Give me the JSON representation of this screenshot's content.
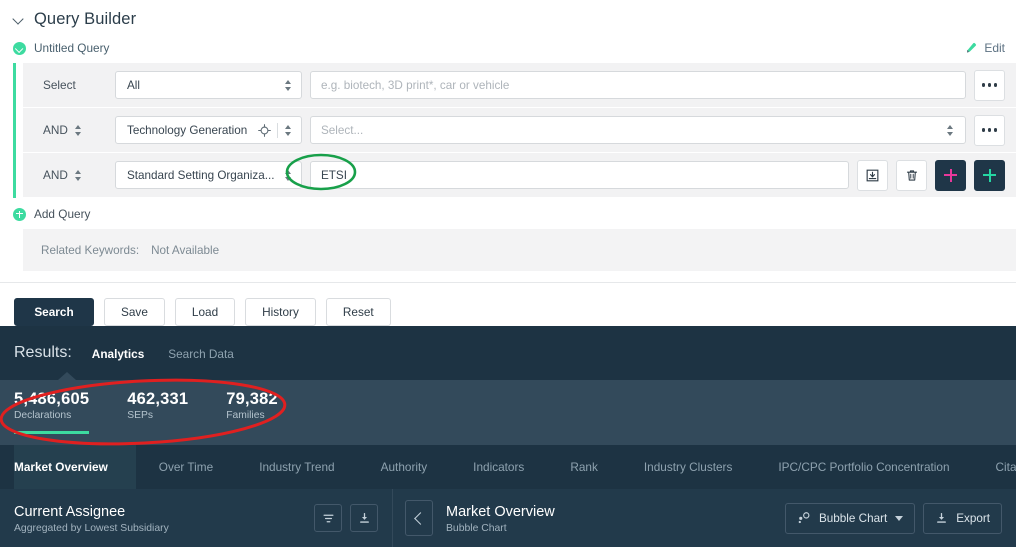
{
  "query_builder": {
    "title": "Query Builder",
    "query_name": "Untitled Query",
    "edit_label": "Edit",
    "add_query_label": "Add Query",
    "rows": [
      {
        "connector": "Select",
        "field": "All",
        "value": "",
        "placeholder": "e.g. biotech, 3D print*, car or vehicle",
        "menu_label": "•••"
      },
      {
        "connector": "AND",
        "field": "Technology Generation",
        "value": "",
        "placeholder": "Select...",
        "menu_label": "•••"
      },
      {
        "connector": "AND",
        "field": "Standard Setting Organiza...",
        "value": "ETSI",
        "placeholder": "",
        "menu_label": ""
      }
    ],
    "keywords": {
      "label": "Related Keywords:",
      "value": "Not Available"
    },
    "buttons": [
      {
        "label": "Search",
        "primary": true
      },
      {
        "label": "Save",
        "primary": false
      },
      {
        "label": "Load",
        "primary": false
      },
      {
        "label": "History",
        "primary": false
      },
      {
        "label": "Reset",
        "primary": false
      }
    ]
  },
  "results": {
    "label": "Results:",
    "tabs": [
      {
        "label": "Analytics",
        "active": true
      },
      {
        "label": "Search Data",
        "active": false
      }
    ],
    "stats": [
      {
        "value": "5,486,605",
        "label": "Declarations",
        "active": true
      },
      {
        "value": "462,331",
        "label": "SEPs",
        "active": false
      },
      {
        "value": "79,382",
        "label": "Families",
        "active": false
      }
    ],
    "nav_tabs": [
      {
        "label": "Market Overview",
        "active": true
      },
      {
        "label": "Over Time",
        "active": false
      },
      {
        "label": "Industry Trend",
        "active": false
      },
      {
        "label": "Authority",
        "active": false
      },
      {
        "label": "Indicators",
        "active": false
      },
      {
        "label": "Rank",
        "active": false
      },
      {
        "label": "Industry Clusters",
        "active": false
      },
      {
        "label": "IPC/CPC Portfolio Concentration",
        "active": false
      },
      {
        "label": "Citatio",
        "active": false
      }
    ],
    "panel_left": {
      "title": "Current Assignee",
      "subtitle": "Aggregated by Lowest Subsidiary"
    },
    "panel_right": {
      "title": "Market Overview",
      "subtitle": "Bubble Chart",
      "chart_type": "Bubble Chart",
      "export_label": "Export"
    }
  },
  "colors": {
    "accent_green": "#3ddba0",
    "dark_navy": "#1d3343",
    "stats_band": "#334a5b",
    "panel_bar": "#223a4b",
    "pink": "#e8389b",
    "annotation_red": "#e02020",
    "annotation_green": "#18a04a"
  }
}
